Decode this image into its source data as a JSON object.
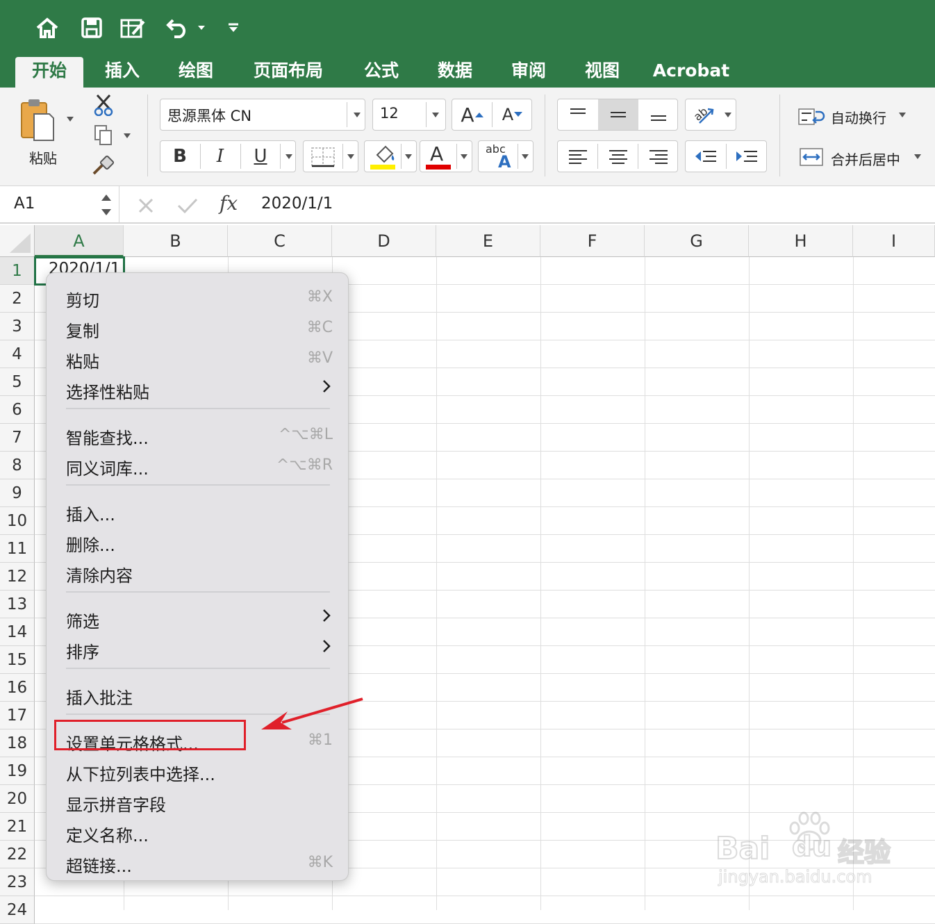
{
  "quick_access": {
    "icons": [
      "home-icon",
      "save-icon",
      "edit-sheet-icon",
      "undo-icon",
      "undo-dropdown-icon",
      "customize-icon"
    ]
  },
  "tabs": [
    {
      "label": "开始",
      "active": true
    },
    {
      "label": "插入"
    },
    {
      "label": "绘图"
    },
    {
      "label": "页面布局"
    },
    {
      "label": "公式"
    },
    {
      "label": "数据"
    },
    {
      "label": "审阅"
    },
    {
      "label": "视图"
    },
    {
      "label": "Acrobat"
    }
  ],
  "ribbon": {
    "paste_label": "粘贴",
    "font_name": "思源黑体 CN",
    "font_size": "12",
    "bold": "B",
    "italic": "I",
    "underline": "U",
    "font_color_letter": "A",
    "grow_letter": "A",
    "shrink_letter": "A",
    "phonetic_small": "abc",
    "phonetic_big": "A",
    "wrap_text": "自动换行",
    "merge_center": "合并后居中",
    "fill_color": "#ffef00",
    "font_color": "#e00000"
  },
  "formula_bar": {
    "cell_ref": "A1",
    "fx": "fx",
    "value": "2020/1/1"
  },
  "grid": {
    "columns": [
      "A",
      "B",
      "C",
      "D",
      "E",
      "F",
      "G",
      "H",
      "I"
    ],
    "rows": [
      "1",
      "2",
      "3",
      "4",
      "5",
      "6",
      "7",
      "8",
      "9",
      "10",
      "11",
      "12",
      "13",
      "14",
      "15",
      "16",
      "17",
      "18",
      "19",
      "20",
      "21",
      "22",
      "23",
      "24"
    ],
    "cell_a1": "2020/1/1"
  },
  "context_menu": {
    "groups": [
      [
        {
          "label": "剪切",
          "shortcut": "⌘X"
        },
        {
          "label": "复制",
          "shortcut": "⌘C"
        },
        {
          "label": "粘贴",
          "shortcut": "⌘V"
        },
        {
          "label": "选择性粘贴",
          "submenu": true
        }
      ],
      [
        {
          "label": "智能查找...",
          "shortcut": "^⌥⌘L"
        },
        {
          "label": "同义词库...",
          "shortcut": "^⌥⌘R"
        }
      ],
      [
        {
          "label": "插入..."
        },
        {
          "label": "删除..."
        },
        {
          "label": "清除内容"
        }
      ],
      [
        {
          "label": "筛选",
          "submenu": true
        },
        {
          "label": "排序",
          "submenu": true
        }
      ],
      [
        {
          "label": "插入批注"
        }
      ],
      [
        {
          "label": "设置单元格格式...",
          "shortcut": "⌘1",
          "highlighted": true
        },
        {
          "label": "从下拉列表中选择..."
        },
        {
          "label": "显示拼音字段"
        },
        {
          "label": "定义名称..."
        },
        {
          "label": "超链接...",
          "shortcut": "⌘K"
        }
      ]
    ]
  },
  "annotation": {
    "highlight_color": "#e0202a",
    "arrow_color": "#e0202a"
  },
  "watermark": {
    "brand": "Bai",
    "brand2": "du",
    "sub": "经验",
    "url": "jingyan.baidu.com"
  }
}
